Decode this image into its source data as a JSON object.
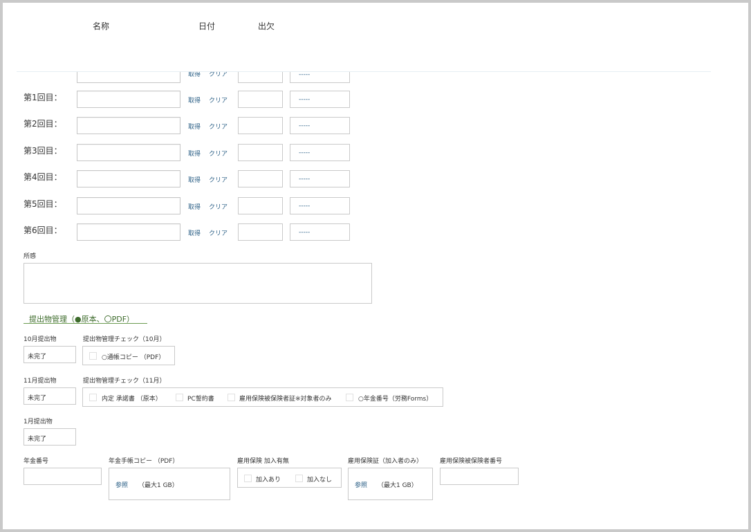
{
  "header": {
    "col_name": "名称",
    "col_date": "日付",
    "col_attendance": "出欠"
  },
  "rows": [
    {
      "label": ""
    },
    {
      "label": "第1回目："
    },
    {
      "label": "第2回目："
    },
    {
      "label": "第3回目："
    },
    {
      "label": "第4回目："
    },
    {
      "label": "第5回目："
    },
    {
      "label": "第6回目："
    }
  ],
  "row_links": {
    "get": "取得",
    "clear": "クリア"
  },
  "attendance_default": "-----",
  "impression": {
    "label": "所感"
  },
  "submission": {
    "title": "提出物管理（●原本、〇PDF）",
    "oct": {
      "label": "10月提出物",
      "status": "未完了",
      "check_label": "提出物管理チェック（10月）",
      "items": [
        "○通帳コピー （PDF）"
      ]
    },
    "nov": {
      "label": "11月提出物",
      "status": "未完了",
      "check_label": "提出物管理チェック（11月）",
      "items": [
        "内定 承諾書 （原本）",
        "PC誓約書",
        "雇用保険被保険者証※対象者のみ",
        "○年金番号（労務Forms）"
      ]
    },
    "jan": {
      "label": "1月提出物",
      "status": "未完了"
    }
  },
  "bottom": {
    "pension_no": {
      "label": "年金番号"
    },
    "pension_copy": {
      "label": "年金手帳コピー （PDF）",
      "browse": "参照",
      "max": "（最大1 GB）"
    },
    "insurance": {
      "label": "雇用保険 加入有無",
      "opt_yes": "加入あり",
      "opt_no": "加入なし"
    },
    "insurance_cert": {
      "label": "雇用保険証（加入者のみ）",
      "browse": "参照",
      "max": "（最大1 GB）"
    },
    "insured_no": {
      "label": "雇用保険被保険者番号"
    }
  }
}
